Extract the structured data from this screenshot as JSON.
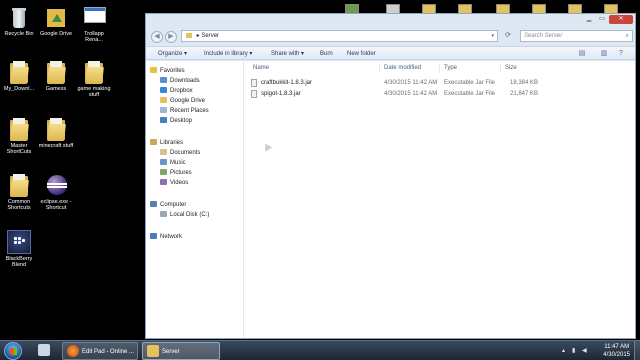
{
  "desktop": {
    "icons": [
      {
        "label": "Recycle Bin",
        "kind": "recycle-bin"
      },
      {
        "label": "Google Drive",
        "kind": "google-drive"
      },
      {
        "label": "Trollapp Rena...",
        "kind": "window"
      },
      {
        "label": "My_Downl...",
        "kind": "folder"
      },
      {
        "label": "Gamess",
        "kind": "folder"
      },
      {
        "label": "game making stuff",
        "kind": "folder"
      },
      {
        "label": "Master ShortCuts",
        "kind": "folder"
      },
      {
        "label": "minecraft stuff",
        "kind": "folder"
      },
      {
        "label": "Common Shortcuts",
        "kind": "folder"
      },
      {
        "label": "eclipse.exe - Shortcut",
        "kind": "eclipse"
      },
      {
        "label": "BlackBerry Blend",
        "kind": "blackberry"
      }
    ]
  },
  "explorer": {
    "address_path": "Server",
    "search_placeholder": "Search Server",
    "toolbar": {
      "organize": "Organize ▾",
      "include_in_library": "Include in library ▾",
      "share_with": "Share with ▾",
      "burn": "Burn",
      "new_folder": "New folder"
    },
    "nav": {
      "favorites": "Favorites",
      "downloads": "Downloads",
      "dropbox": "Dropbox",
      "google_drive": "Google Drive",
      "recent_places": "Recent Places",
      "desktop": "Desktop",
      "libraries": "Libraries",
      "documents": "Documents",
      "music": "Music",
      "pictures": "Pictures",
      "videos": "Videos",
      "computer": "Computer",
      "local_disk": "Local Disk (C:)",
      "network": "Network"
    },
    "columns": {
      "name": "Name",
      "date_modified": "Date modified",
      "type": "Type",
      "size": "Size"
    },
    "files": [
      {
        "name": "craftbukkit-1.8.3.jar",
        "date": "4/30/2015 11:42 AM",
        "type": "Executable Jar File",
        "size": "18,384 KB"
      },
      {
        "name": "spigot-1.8.3.jar",
        "date": "4/30/2015 11:42 AM",
        "type": "Executable Jar File",
        "size": "21,847 KB"
      }
    ]
  },
  "taskbar": {
    "buttons": [
      {
        "label": "Edit Pad - Online ..."
      },
      {
        "label": "Server"
      }
    ],
    "clock_time": "11:47 AM",
    "clock_date": "4/30/2015"
  },
  "colors": {
    "window_frame": "#dde8f3",
    "close_button": "#c9463d",
    "folder": "#e3c15c",
    "taskbar": "#2b3745"
  }
}
